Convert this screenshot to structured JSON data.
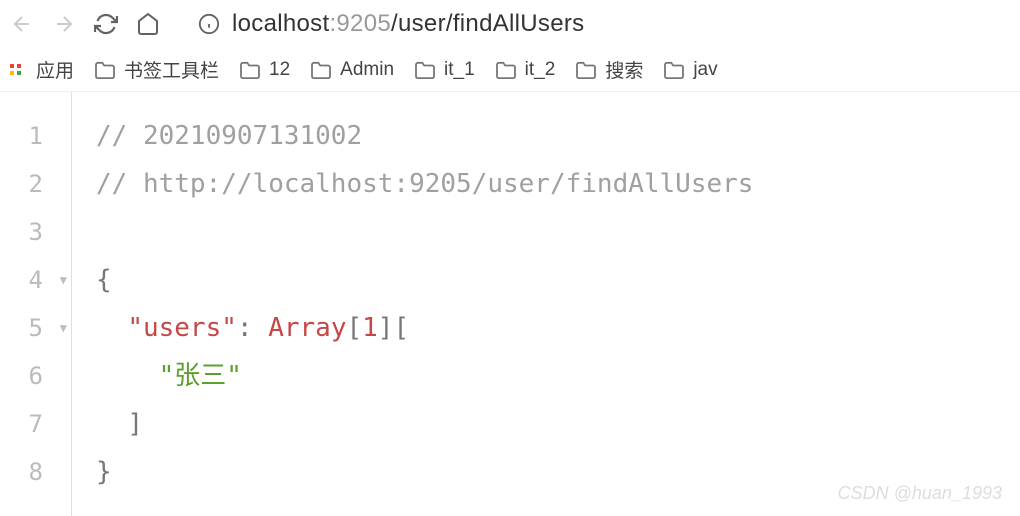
{
  "nav": {
    "url_host": "localhost",
    "url_port": ":9205",
    "url_path": "/user/findAllUsers"
  },
  "bookmarks": {
    "apps_label": "应用",
    "items": [
      {
        "label": "书签工具栏"
      },
      {
        "label": "12"
      },
      {
        "label": "Admin"
      },
      {
        "label": "it_1"
      },
      {
        "label": "it_2"
      },
      {
        "label": "搜索"
      },
      {
        "label": "jav"
      }
    ]
  },
  "code": {
    "line_numbers": [
      "1",
      "2",
      "3",
      "4",
      "5",
      "6",
      "7",
      "8"
    ],
    "comment_prefix": "// ",
    "timestamp": "20210907131002",
    "url_comment": "http://localhost:9205/user/findAllUsers",
    "brace_open": "{",
    "key_users": "\"users\"",
    "colon_space": ": ",
    "array_word": "Array",
    "bracket_open": "[",
    "array_count": "1",
    "bracket_close": "]",
    "bracket_open2": "[",
    "string_val": "\"张三\"",
    "bracket_close2": "]",
    "brace_close": "}"
  },
  "watermark": "CSDN @huan_1993"
}
